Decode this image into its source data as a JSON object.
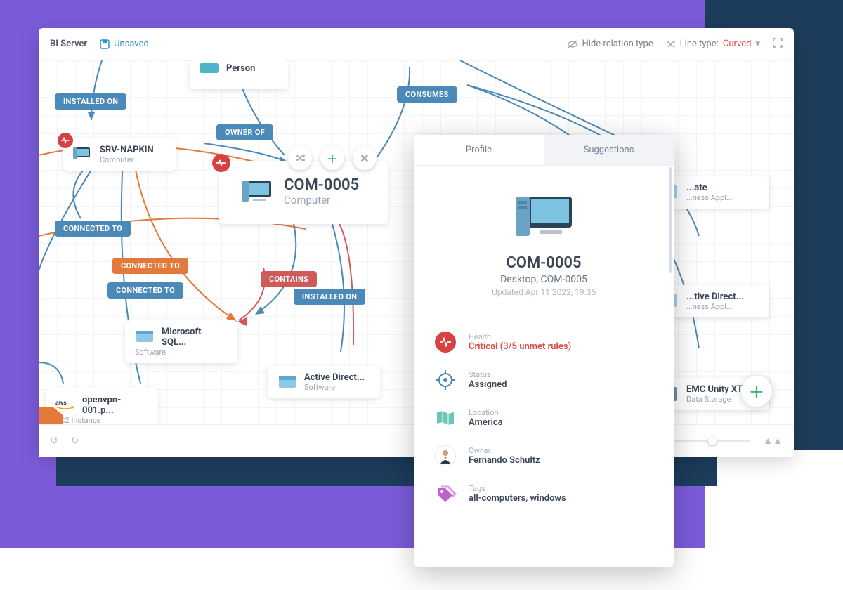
{
  "topbar": {
    "title": "BI Server",
    "status": "Unsaved",
    "hide_relation": "Hide relation type",
    "linetype_label": "Line type:",
    "linetype_value": "Curved"
  },
  "pills": {
    "installed_on_1": "INSTALLED ON",
    "owner_of": "OWNER OF",
    "consumes": "CONSUMES",
    "connected_to_1": "CONNECTED TO",
    "connected_to_2": "CONNECTED TO",
    "connected_to_3": "CONNECTED TO",
    "contains": "CONTAINS",
    "installed_on_2": "INSTALLED ON"
  },
  "nodes": {
    "person": {
      "title": "Person",
      "sub": ""
    },
    "srv_napkin": {
      "title": "SRV-NAPKIN",
      "sub": "Computer"
    },
    "com0005": {
      "title": "COM-0005",
      "sub": "Computer"
    },
    "mssql": {
      "title": "Microsoft SQL...",
      "sub": "Software"
    },
    "ad": {
      "title": "Active Direct...",
      "sub": "Software"
    },
    "openvpn": {
      "title": "openvpn-001.p...",
      "sub": "EC2 Instance"
    },
    "app1": {
      "title": "...ate",
      "sub": "...ness Appl..."
    },
    "app2": {
      "title": "...tive Direct...",
      "sub": "...ness Appl..."
    },
    "storage": {
      "title": "EMC Unity XT ...",
      "sub": "Data Storage"
    }
  },
  "panel": {
    "tabs": {
      "profile": "Profile",
      "suggestions": "Suggestions"
    },
    "hero": {
      "title": "COM-0005",
      "sub": "Desktop, COM-0005",
      "meta": "Updated Apr 11 2022, 19:35"
    },
    "attrs": [
      {
        "label": "Health",
        "value": "Critical (3/5 unmet rules)",
        "red": true,
        "icon": "health"
      },
      {
        "label": "Status",
        "value": "Assigned",
        "icon": "status"
      },
      {
        "label": "Location",
        "value": "America",
        "icon": "location"
      },
      {
        "label": "Owner",
        "value": "Fernando Schultz",
        "icon": "owner"
      },
      {
        "label": "Tags",
        "value": "all-computers, windows",
        "icon": "tags"
      }
    ]
  },
  "colors": {
    "purple": "#7b5bd9",
    "navy": "#1d3d5c",
    "pill_blue": "#4a89b8",
    "pill_orange": "#e37a3b",
    "pill_red": "#cf5a5a",
    "accent_green": "#3db47a",
    "critical_red": "#e24a4a"
  }
}
